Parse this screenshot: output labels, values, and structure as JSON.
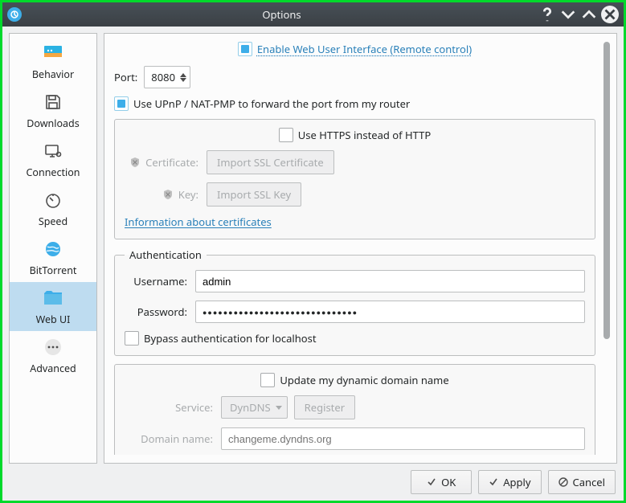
{
  "window": {
    "title": "Options"
  },
  "sidebar": {
    "items": [
      {
        "label": "Behavior"
      },
      {
        "label": "Downloads"
      },
      {
        "label": "Connection"
      },
      {
        "label": "Speed"
      },
      {
        "label": "BitTorrent"
      },
      {
        "label": "Web UI"
      },
      {
        "label": "Advanced"
      }
    ],
    "selected_index": 5
  },
  "webui": {
    "enable_label": "Enable Web User Interface (Remote control)",
    "enable_checked": true,
    "port_label": "Port:",
    "port_value": "8080",
    "upnp_label": "Use UPnP / NAT-PMP to forward the port from my router",
    "upnp_checked": true,
    "https": {
      "use_https_label": "Use HTTPS instead of HTTP",
      "use_https_checked": false,
      "cert_label": "Certificate:",
      "cert_button": "Import SSL Certificate",
      "key_label": "Key:",
      "key_button": "Import SSL Key",
      "info_link": "Information about certificates"
    },
    "auth": {
      "heading": "Authentication",
      "username_label": "Username:",
      "username_value": "admin",
      "password_label": "Password:",
      "password_display": "●●●●●●●●●●●●●●●●●●●●●●●●●●●●●●",
      "bypass_label": "Bypass authentication for localhost",
      "bypass_checked": false
    },
    "ddns": {
      "update_label": "Update my dynamic domain name",
      "update_checked": false,
      "service_label": "Service:",
      "service_value": "DynDNS",
      "register_button": "Register",
      "domain_label": "Domain name:",
      "domain_placeholder": "changeme.dyndns.org"
    }
  },
  "footer": {
    "ok": "OK",
    "apply": "Apply",
    "cancel": "Cancel"
  }
}
